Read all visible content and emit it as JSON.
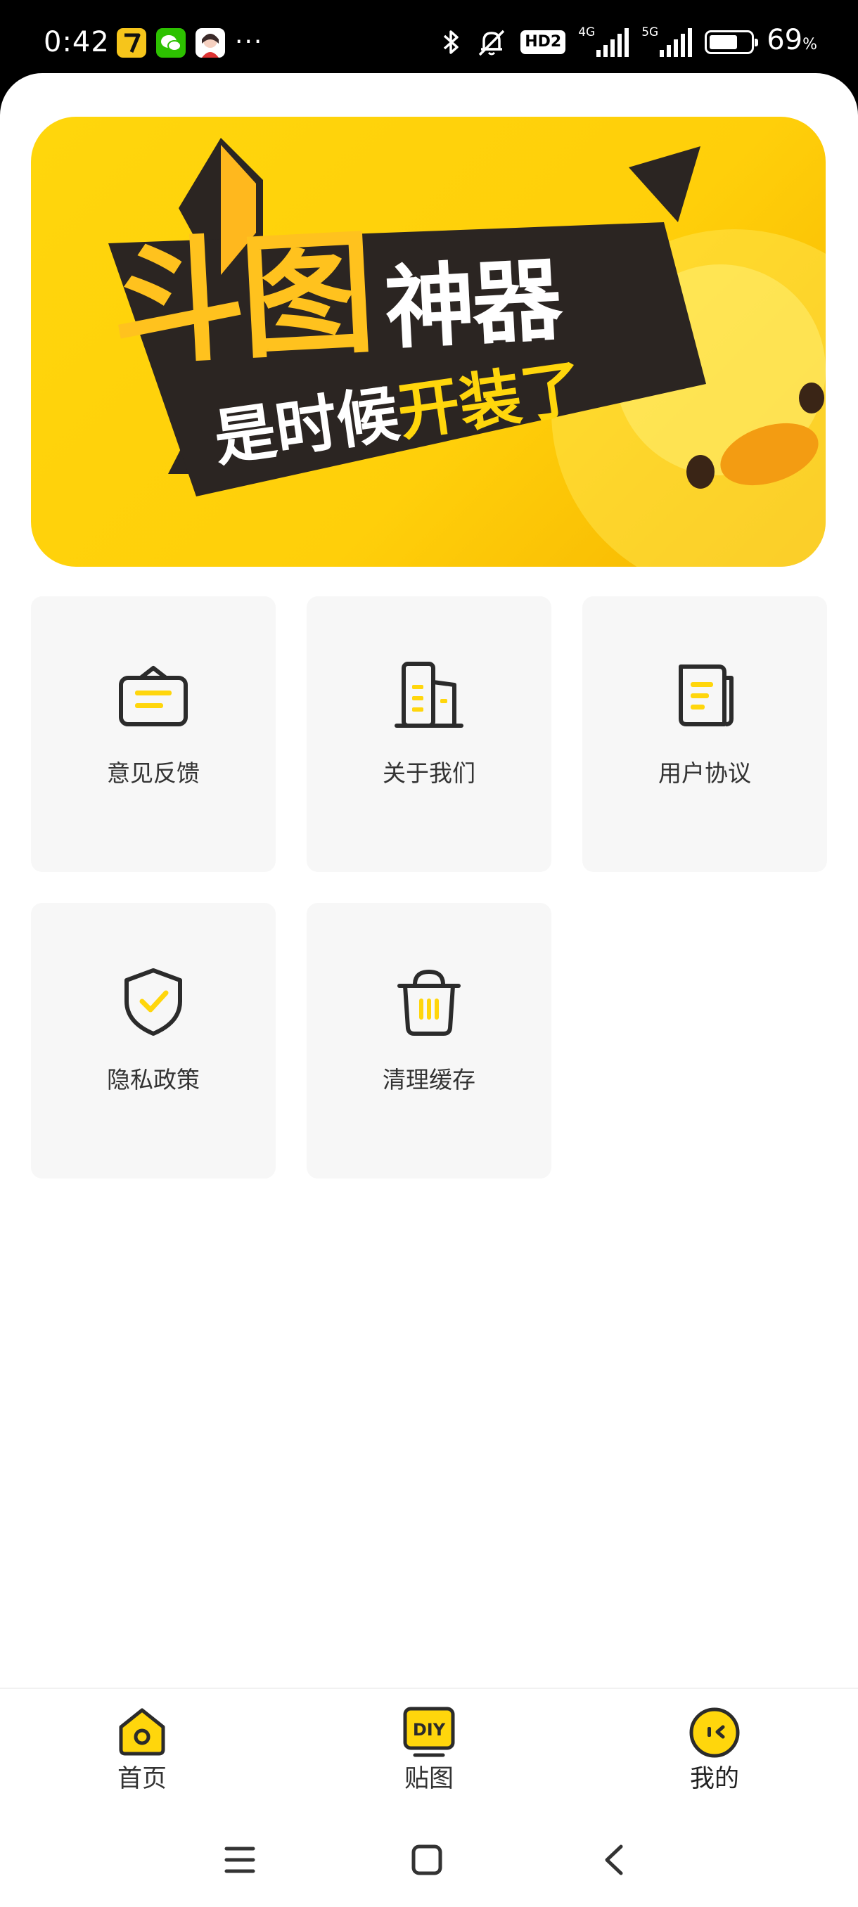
{
  "status_bar": {
    "time": "0:42",
    "more": "···",
    "hd_badge": "HD2",
    "net_a": "4G",
    "net_b": "5G",
    "battery_level": 0.69,
    "battery_percent": "69",
    "percent_sign": "%"
  },
  "banner": {
    "line1_a": "斗图",
    "line1_b": "神器",
    "line2_a": "是时候",
    "line2_b": "开装了"
  },
  "menu": [
    {
      "label": "意见反馈",
      "icon": "feedback-bag-icon"
    },
    {
      "label": "关于我们",
      "icon": "buildings-icon"
    },
    {
      "label": "用户协议",
      "icon": "document-icon"
    },
    {
      "label": "隐私政策",
      "icon": "shield-check-icon"
    },
    {
      "label": "清理缓存",
      "icon": "trash-bin-icon"
    }
  ],
  "bottom_nav": [
    {
      "label": "首页",
      "icon": "home-icon"
    },
    {
      "label": "贴图",
      "icon": "diy-sticker-icon",
      "icon_text": "DIY"
    },
    {
      "label": "我的",
      "icon": "face-icon",
      "active": true
    }
  ],
  "colors": {
    "accent": "#ffd60c",
    "dark": "#2b2b2b",
    "tile_bg": "#f7f7f7"
  }
}
